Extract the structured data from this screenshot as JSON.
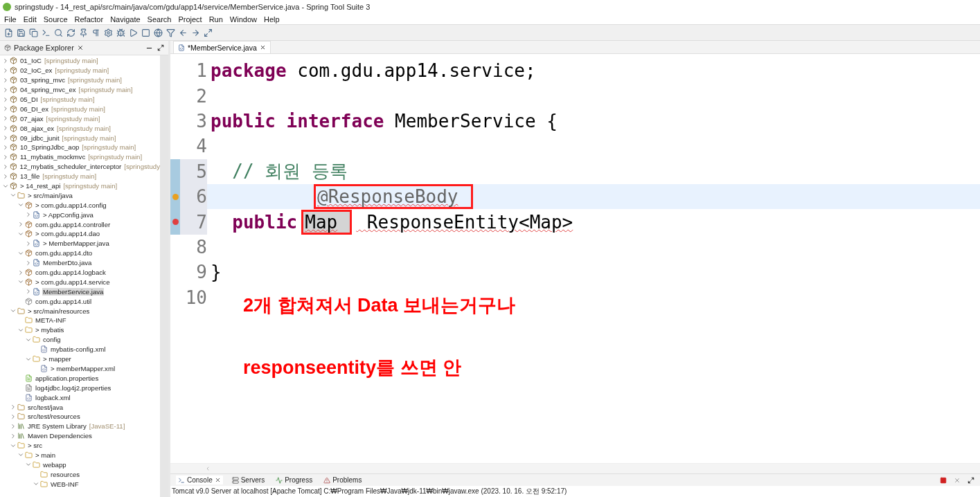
{
  "window": {
    "title": "springstudy - 14_rest_api/src/main/java/com/gdu/app14/service/MemberService.java - Spring Tool Suite 3"
  },
  "menu": [
    "File",
    "Edit",
    "Source",
    "Refactor",
    "Navigate",
    "Search",
    "Project",
    "Run",
    "Window",
    "Help"
  ],
  "explorer": {
    "title": "Package Explorer",
    "items": [
      {
        "label": "01_IoC",
        "suffix": "[springstudy main]",
        "kind": "project",
        "expanded": false,
        "selected": false
      },
      {
        "label": "02_IoC_ex",
        "suffix": "[springstudy main]",
        "kind": "project",
        "expanded": false,
        "selected": false
      },
      {
        "label": "03_spring_mvc",
        "suffix": "[springstudy main]",
        "kind": "project",
        "expanded": false,
        "selected": false
      },
      {
        "label": "04_spring_mvc_ex",
        "suffix": "[springstudy main]",
        "kind": "project",
        "expanded": false,
        "selected": false
      },
      {
        "label": "05_DI",
        "suffix": "[springstudy main]",
        "kind": "project",
        "expanded": false,
        "selected": false
      },
      {
        "label": "06_DI_ex",
        "suffix": "[springstudy main]",
        "kind": "project",
        "expanded": false,
        "selected": false
      },
      {
        "label": "07_ajax",
        "suffix": "[springstudy main]",
        "kind": "project",
        "expanded": false,
        "selected": false
      },
      {
        "label": "08_ajax_ex",
        "suffix": "[springstudy main]",
        "kind": "project",
        "expanded": false,
        "selected": false
      },
      {
        "label": "09_jdbc_junit",
        "suffix": "[springstudy main]",
        "kind": "project",
        "expanded": false,
        "selected": false
      },
      {
        "label": "10_SpringJdbc_aop",
        "suffix": "[springstudy main]",
        "kind": "project",
        "expanded": false,
        "selected": false
      },
      {
        "label": "11_mybatis_mockmvc",
        "suffix": "[springstudy main]",
        "kind": "project",
        "expanded": false,
        "selected": false
      },
      {
        "label": "12_mybatis_scheduler_interceptor",
        "suffix": "[springstudy",
        "kind": "project",
        "expanded": false,
        "selected": false
      },
      {
        "label": "13_file",
        "suffix": "[springstudy main]",
        "kind": "project",
        "expanded": false,
        "selected": false
      },
      {
        "label": "> 14_rest_api",
        "suffix": "[springstudy main]",
        "kind": "project",
        "expanded": true,
        "selected": false,
        "children": [
          {
            "label": "> src/main/java",
            "kind": "source-folder",
            "expanded": true,
            "selected": false,
            "children": [
              {
                "label": "> com.gdu.app14.config",
                "kind": "package",
                "expanded": true,
                "selected": false,
                "children": [
                  {
                    "label": "> AppConfig.java",
                    "kind": "java-file",
                    "expanded": false,
                    "selected": false
                  }
                ]
              },
              {
                "label": "com.gdu.app14.controller",
                "kind": "package",
                "expanded": false,
                "selected": false
              },
              {
                "label": "> com.gdu.app14.dao",
                "kind": "package",
                "expanded": true,
                "selected": false,
                "children": [
                  {
                    "label": "> MemberMapper.java",
                    "kind": "java-file",
                    "expanded": false,
                    "selected": false
                  }
                ]
              },
              {
                "label": "com.gdu.app14.dto",
                "kind": "package",
                "expanded": true,
                "selected": false,
                "children": [
                  {
                    "label": "MemberDto.java",
                    "kind": "java-file",
                    "expanded": false,
                    "selected": false
                  }
                ]
              },
              {
                "label": "com.gdu.app14.logback",
                "kind": "package",
                "expanded": false,
                "selected": false
              },
              {
                "label": "> com.gdu.app14.service",
                "kind": "package",
                "expanded": true,
                "selected": false,
                "children": [
                  {
                    "label": "MemberService.java",
                    "kind": "java-file",
                    "expanded": false,
                    "selected": true
                  }
                ]
              },
              {
                "label": "com.gdu.app14.util",
                "kind": "empty-package",
                "selected": false
              }
            ]
          },
          {
            "label": "> src/main/resources",
            "kind": "source-folder",
            "expanded": true,
            "selected": false,
            "children": [
              {
                "label": "META-INF",
                "kind": "folder",
                "selected": false
              },
              {
                "label": "> mybatis",
                "kind": "folder",
                "expanded": true,
                "selected": false,
                "children": [
                  {
                    "label": "config",
                    "kind": "folder",
                    "expanded": true,
                    "selected": false,
                    "children": [
                      {
                        "label": "mybatis-config.xml",
                        "kind": "xml-file",
                        "selected": false
                      }
                    ]
                  },
                  {
                    "label": "> mapper",
                    "kind": "folder",
                    "expanded": true,
                    "selected": false,
                    "children": [
                      {
                        "label": "> memberMapper.xml",
                        "kind": "xml-file",
                        "selected": false
                      }
                    ]
                  }
                ]
              },
              {
                "label": "application.properties",
                "kind": "spring-file",
                "selected": false
              },
              {
                "label": "log4jdbc.log4j2.properties",
                "kind": "text-file",
                "selected": false
              },
              {
                "label": "logback.xml",
                "kind": "xml-file",
                "selected": false
              }
            ]
          },
          {
            "label": "src/test/java",
            "kind": "source-folder",
            "expanded": false,
            "selected": false
          },
          {
            "label": "src/test/resources",
            "kind": "source-folder",
            "expanded": false,
            "selected": false
          },
          {
            "label": "JRE System Library",
            "suffix": "[JavaSE-11]",
            "kind": "library",
            "expanded": false,
            "selected": false
          },
          {
            "label": "Maven Dependencies",
            "kind": "library",
            "expanded": false,
            "selected": false
          },
          {
            "label": "> src",
            "kind": "folder",
            "expanded": true,
            "selected": false,
            "children": [
              {
                "label": "> main",
                "kind": "folder",
                "expanded": true,
                "selected": false,
                "children": [
                  {
                    "label": "webapp",
                    "kind": "folder",
                    "expanded": true,
                    "selected": false,
                    "children": [
                      {
                        "label": "resources",
                        "kind": "folder",
                        "selected": false
                      },
                      {
                        "label": "WEB-INF",
                        "kind": "folder",
                        "expanded": true,
                        "selected": false
                      }
                    ]
                  }
                ]
              }
            ]
          }
        ]
      }
    ]
  },
  "editor": {
    "tab": {
      "label": "*MemberService.java",
      "selected": true
    },
    "lines": [
      {
        "number": "1",
        "kind": "code",
        "current": false,
        "changed": false,
        "warning": false,
        "error": false,
        "segments": [
          {
            "kind": "keyword",
            "text": "package"
          },
          {
            "kind": "plain",
            "text": " com.gdu.app14.service;"
          }
        ]
      },
      {
        "number": "2",
        "kind": "code",
        "current": false,
        "changed": false,
        "warning": false,
        "error": false
      },
      {
        "number": "3",
        "kind": "code",
        "current": false,
        "changed": false,
        "warning": false,
        "error": false,
        "segments": [
          {
            "kind": "keyword",
            "text": "public interface"
          },
          {
            "kind": "plain",
            "text": " MemberService {"
          }
        ]
      },
      {
        "number": "4",
        "kind": "code",
        "current": false,
        "changed": false,
        "warning": false,
        "error": false
      },
      {
        "number": "5",
        "kind": "code",
        "current": false,
        "changed": true,
        "warning": false,
        "error": false,
        "segments": [
          {
            "kind": "comment",
            "text": "  // 회원 등록"
          }
        ]
      },
      {
        "number": "6",
        "current": true,
        "changed": true,
        "warning": true,
        "error": false,
        "kind": "nested",
        "segments": [
          {
            "kind": "annotation",
            "text": "@ResponseBody",
            "squiggle": true,
            "boxed": true
          }
        ]
      },
      {
        "number": "7",
        "kind": "code",
        "current": false,
        "changed": true,
        "warning": false,
        "error": true,
        "segments": [
          {
            "kind": "keyword",
            "text": "  public"
          },
          {
            "kind": "plain",
            "text": "Map",
            "squiggle": true,
            "boxed": true,
            "occurrence": true
          },
          {
            "kind": "plain",
            "text": " ResponseEntity<Map>",
            "squiggle": true
          }
        ]
      },
      {
        "number": "8",
        "kind": "code",
        "current": false,
        "changed": false,
        "warning": false,
        "error": false
      },
      {
        "number": "9",
        "kind": "code",
        "current": false,
        "changed": false,
        "warning": false,
        "error": false,
        "segments": [
          {
            "kind": "plain",
            "text": "}"
          }
        ]
      },
      {
        "number": "10",
        "kind": "code",
        "current": false,
        "changed": false,
        "warning": false,
        "error": false
      }
    ],
    "notes": [
      "2개 합쳐져서 Data 보내는거구나",
      "responseentity를 쓰면 안"
    ]
  },
  "console": {
    "tabs": [
      {
        "label": "Console",
        "kind": "console",
        "selected": true
      },
      {
        "label": "Servers",
        "kind": "servers",
        "selected": false
      },
      {
        "label": "Progress",
        "kind": "progress",
        "selected": false
      },
      {
        "label": "Problems",
        "kind": "problems",
        "selected": false
      }
    ],
    "status": "Tomcat v9.0 Server at localhost [Apache Tomcat] C:₩Program Files₩Java₩jdk-11₩bin₩javaw.exe  (2023. 10. 16. 오전 9:52:17)"
  }
}
